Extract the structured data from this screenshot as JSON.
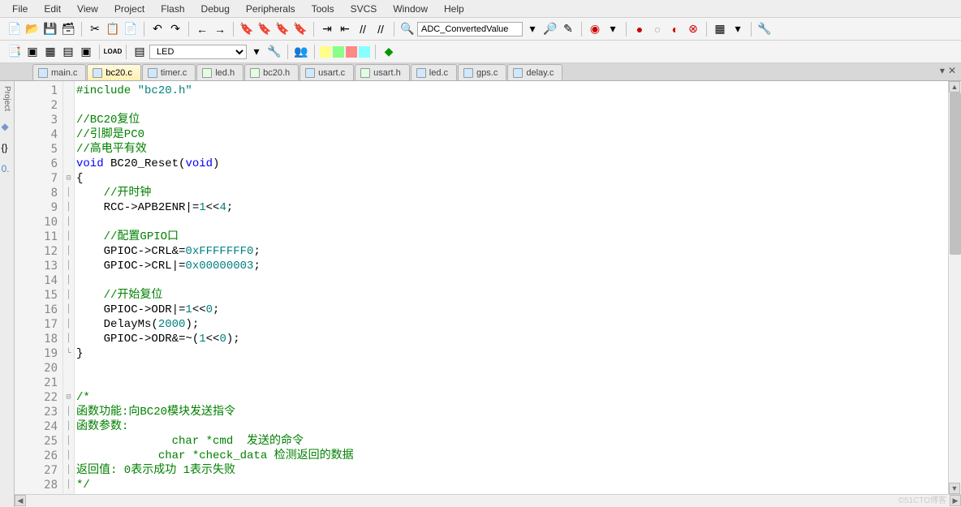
{
  "menu": [
    "File",
    "Edit",
    "View",
    "Project",
    "Flash",
    "Debug",
    "Peripherals",
    "Tools",
    "SVCS",
    "Window",
    "Help"
  ],
  "toolbar1": {
    "search_value": "ADC_ConvertedValue"
  },
  "toolbar2": {
    "target_value": "LED",
    "load_label": "LOAD"
  },
  "tabs": [
    {
      "name": "main.c",
      "type": "c"
    },
    {
      "name": "bc20.c",
      "type": "c",
      "active": true
    },
    {
      "name": "timer.c",
      "type": "c"
    },
    {
      "name": "led.h",
      "type": "h"
    },
    {
      "name": "bc20.h",
      "type": "h"
    },
    {
      "name": "usart.c",
      "type": "c"
    },
    {
      "name": "usart.h",
      "type": "h"
    },
    {
      "name": "led.c",
      "type": "c"
    },
    {
      "name": "gps.c",
      "type": "c"
    },
    {
      "name": "delay.c",
      "type": "c"
    }
  ],
  "sidebar_label": "Project",
  "code": {
    "lines": [
      {
        "n": 1,
        "fold": "",
        "html": "<span class='c-pp'>#include</span> <span class='c-str'>\"bc20.h\"</span>"
      },
      {
        "n": 2,
        "fold": "",
        "html": ""
      },
      {
        "n": 3,
        "fold": "",
        "html": "<span class='c-cmt'>//BC20复位</span>"
      },
      {
        "n": 4,
        "fold": "",
        "html": "<span class='c-cmt'>//引脚是PC0</span>"
      },
      {
        "n": 5,
        "fold": "",
        "html": "<span class='c-cmt'>//高电平有效</span>"
      },
      {
        "n": 6,
        "fold": "",
        "html": "<span class='c-kw'>void</span> BC20_Reset(<span class='c-kw'>void</span>)"
      },
      {
        "n": 7,
        "fold": "⊟",
        "html": "{"
      },
      {
        "n": 8,
        "fold": "│",
        "html": "    <span class='c-cmt'>//开时钟</span>"
      },
      {
        "n": 9,
        "fold": "│",
        "html": "    RCC-&gt;APB2ENR|=<span class='c-num'>1</span>&lt;&lt;<span class='c-num'>4</span>;"
      },
      {
        "n": 10,
        "fold": "│",
        "html": ""
      },
      {
        "n": 11,
        "fold": "│",
        "html": "    <span class='c-cmt'>//配置GPIO口</span>"
      },
      {
        "n": 12,
        "fold": "│",
        "html": "    GPIOC-&gt;CRL&amp;=<span class='c-num'>0xFFFFFFF0</span>;"
      },
      {
        "n": 13,
        "fold": "│",
        "html": "    GPIOC-&gt;CRL|=<span class='c-num'>0x00000003</span>;"
      },
      {
        "n": 14,
        "fold": "│",
        "html": ""
      },
      {
        "n": 15,
        "fold": "│",
        "html": "    <span class='c-cmt'>//开始复位</span>"
      },
      {
        "n": 16,
        "fold": "│",
        "html": "    GPIOC-&gt;ODR|=<span class='c-num'>1</span>&lt;&lt;<span class='c-num'>0</span>;"
      },
      {
        "n": 17,
        "fold": "│",
        "html": "    DelayMs(<span class='c-num'>2000</span>);"
      },
      {
        "n": 18,
        "fold": "│",
        "html": "    GPIOC-&gt;ODR&amp;=~(<span class='c-num'>1</span>&lt;&lt;<span class='c-num'>0</span>);"
      },
      {
        "n": 19,
        "fold": "└",
        "html": "}"
      },
      {
        "n": 20,
        "fold": "",
        "html": ""
      },
      {
        "n": 21,
        "fold": "",
        "html": ""
      },
      {
        "n": 22,
        "fold": "⊟",
        "html": "<span class='c-cmt'>/*</span>"
      },
      {
        "n": 23,
        "fold": "│",
        "html": "<span class='c-cmt'>函数功能:向BC20模块发送指令</span>"
      },
      {
        "n": 24,
        "fold": "│",
        "html": "<span class='c-cmt'>函数参数:</span>"
      },
      {
        "n": 25,
        "fold": "│",
        "html": "<span class='c-cmt'>              char *cmd  发送的命令</span>"
      },
      {
        "n": 26,
        "fold": "│",
        "html": "<span class='c-cmt'>            char *check_data 检测返回的数据</span>"
      },
      {
        "n": 27,
        "fold": "│",
        "html": "<span class='c-cmt'>返回值: 0表示成功 1表示失败</span>"
      },
      {
        "n": 28,
        "fold": "│",
        "html": "<span class='c-cmt'>*/</span>"
      }
    ]
  },
  "watermark": "©51CTO博客"
}
